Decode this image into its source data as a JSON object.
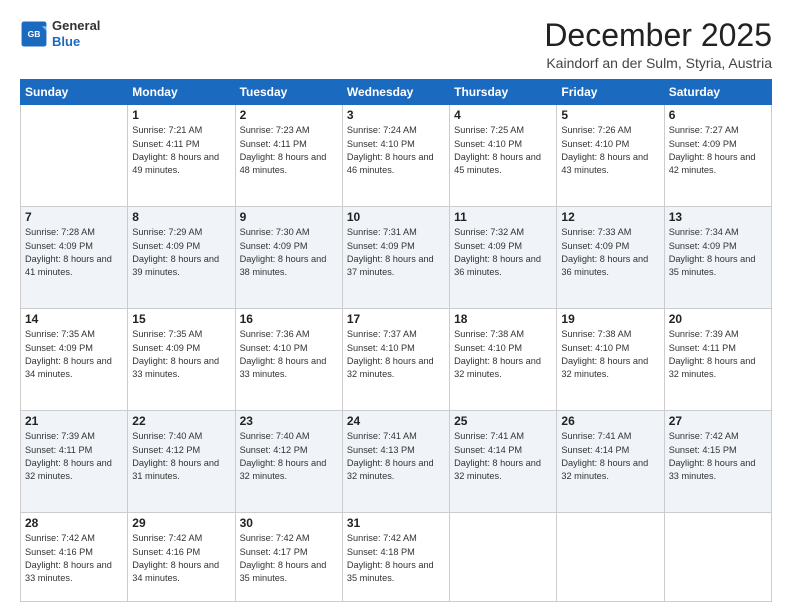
{
  "header": {
    "logo_general": "General",
    "logo_blue": "Blue",
    "month": "December 2025",
    "location": "Kaindorf an der Sulm, Styria, Austria"
  },
  "days_of_week": [
    "Sunday",
    "Monday",
    "Tuesday",
    "Wednesday",
    "Thursday",
    "Friday",
    "Saturday"
  ],
  "weeks": [
    {
      "cells": [
        {
          "day": "",
          "empty": true
        },
        {
          "day": "1",
          "sunrise": "7:21 AM",
          "sunset": "4:11 PM",
          "daylight": "8 hours and 49 minutes."
        },
        {
          "day": "2",
          "sunrise": "7:23 AM",
          "sunset": "4:11 PM",
          "daylight": "8 hours and 48 minutes."
        },
        {
          "day": "3",
          "sunrise": "7:24 AM",
          "sunset": "4:10 PM",
          "daylight": "8 hours and 46 minutes."
        },
        {
          "day": "4",
          "sunrise": "7:25 AM",
          "sunset": "4:10 PM",
          "daylight": "8 hours and 45 minutes."
        },
        {
          "day": "5",
          "sunrise": "7:26 AM",
          "sunset": "4:10 PM",
          "daylight": "8 hours and 43 minutes."
        },
        {
          "day": "6",
          "sunrise": "7:27 AM",
          "sunset": "4:09 PM",
          "daylight": "8 hours and 42 minutes."
        }
      ]
    },
    {
      "cells": [
        {
          "day": "7",
          "sunrise": "7:28 AM",
          "sunset": "4:09 PM",
          "daylight": "8 hours and 41 minutes."
        },
        {
          "day": "8",
          "sunrise": "7:29 AM",
          "sunset": "4:09 PM",
          "daylight": "8 hours and 39 minutes."
        },
        {
          "day": "9",
          "sunrise": "7:30 AM",
          "sunset": "4:09 PM",
          "daylight": "8 hours and 38 minutes."
        },
        {
          "day": "10",
          "sunrise": "7:31 AM",
          "sunset": "4:09 PM",
          "daylight": "8 hours and 37 minutes."
        },
        {
          "day": "11",
          "sunrise": "7:32 AM",
          "sunset": "4:09 PM",
          "daylight": "8 hours and 36 minutes."
        },
        {
          "day": "12",
          "sunrise": "7:33 AM",
          "sunset": "4:09 PM",
          "daylight": "8 hours and 36 minutes."
        },
        {
          "day": "13",
          "sunrise": "7:34 AM",
          "sunset": "4:09 PM",
          "daylight": "8 hours and 35 minutes."
        }
      ]
    },
    {
      "cells": [
        {
          "day": "14",
          "sunrise": "7:35 AM",
          "sunset": "4:09 PM",
          "daylight": "8 hours and 34 minutes."
        },
        {
          "day": "15",
          "sunrise": "7:35 AM",
          "sunset": "4:09 PM",
          "daylight": "8 hours and 33 minutes."
        },
        {
          "day": "16",
          "sunrise": "7:36 AM",
          "sunset": "4:10 PM",
          "daylight": "8 hours and 33 minutes."
        },
        {
          "day": "17",
          "sunrise": "7:37 AM",
          "sunset": "4:10 PM",
          "daylight": "8 hours and 32 minutes."
        },
        {
          "day": "18",
          "sunrise": "7:38 AM",
          "sunset": "4:10 PM",
          "daylight": "8 hours and 32 minutes."
        },
        {
          "day": "19",
          "sunrise": "7:38 AM",
          "sunset": "4:10 PM",
          "daylight": "8 hours and 32 minutes."
        },
        {
          "day": "20",
          "sunrise": "7:39 AM",
          "sunset": "4:11 PM",
          "daylight": "8 hours and 32 minutes."
        }
      ]
    },
    {
      "cells": [
        {
          "day": "21",
          "sunrise": "7:39 AM",
          "sunset": "4:11 PM",
          "daylight": "8 hours and 32 minutes."
        },
        {
          "day": "22",
          "sunrise": "7:40 AM",
          "sunset": "4:12 PM",
          "daylight": "8 hours and 31 minutes."
        },
        {
          "day": "23",
          "sunrise": "7:40 AM",
          "sunset": "4:12 PM",
          "daylight": "8 hours and 32 minutes."
        },
        {
          "day": "24",
          "sunrise": "7:41 AM",
          "sunset": "4:13 PM",
          "daylight": "8 hours and 32 minutes."
        },
        {
          "day": "25",
          "sunrise": "7:41 AM",
          "sunset": "4:14 PM",
          "daylight": "8 hours and 32 minutes."
        },
        {
          "day": "26",
          "sunrise": "7:41 AM",
          "sunset": "4:14 PM",
          "daylight": "8 hours and 32 minutes."
        },
        {
          "day": "27",
          "sunrise": "7:42 AM",
          "sunset": "4:15 PM",
          "daylight": "8 hours and 33 minutes."
        }
      ]
    },
    {
      "cells": [
        {
          "day": "28",
          "sunrise": "7:42 AM",
          "sunset": "4:16 PM",
          "daylight": "8 hours and 33 minutes."
        },
        {
          "day": "29",
          "sunrise": "7:42 AM",
          "sunset": "4:16 PM",
          "daylight": "8 hours and 34 minutes."
        },
        {
          "day": "30",
          "sunrise": "7:42 AM",
          "sunset": "4:17 PM",
          "daylight": "8 hours and 35 minutes."
        },
        {
          "day": "31",
          "sunrise": "7:42 AM",
          "sunset": "4:18 PM",
          "daylight": "8 hours and 35 minutes."
        },
        {
          "day": "",
          "empty": true
        },
        {
          "day": "",
          "empty": true
        },
        {
          "day": "",
          "empty": true
        }
      ]
    }
  ]
}
